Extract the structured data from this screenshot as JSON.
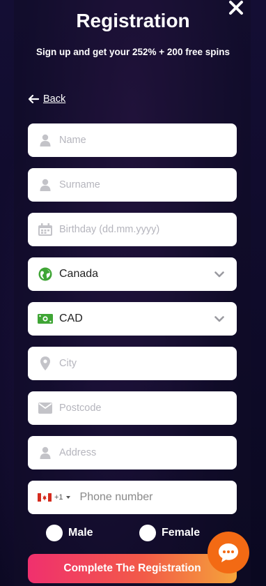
{
  "modal": {
    "title": "Registration",
    "subtitle": "Sign up and get your 252% + 200 free spins",
    "close_icon": "close-icon"
  },
  "back": {
    "label": "Back",
    "icon": "arrow-left-icon"
  },
  "fields": {
    "name": {
      "placeholder": "Name",
      "icon": "user-icon"
    },
    "surname": {
      "placeholder": "Surname",
      "icon": "user-icon"
    },
    "birthday": {
      "placeholder": "Birthday (dd.mm.yyyy)",
      "icon": "calendar-icon"
    },
    "country": {
      "value": "Canada",
      "icon": "globe-icon"
    },
    "currency": {
      "value": "CAD",
      "icon": "banknote-icon"
    },
    "city": {
      "placeholder": "City",
      "icon": "location-pin-icon"
    },
    "postcode": {
      "placeholder": "Postcode",
      "icon": "mailbox-icon"
    },
    "address": {
      "placeholder": "Address",
      "icon": "user-icon"
    },
    "phone": {
      "code": "+1",
      "placeholder": "Phone number",
      "flag": "canada-flag-icon"
    }
  },
  "gender": {
    "male": "Male",
    "female": "Female"
  },
  "submit_label": "Complete The Registration",
  "colors": {
    "accent_green": "#3fa535",
    "button_gradient_start": "#f0306e",
    "button_gradient_end": "#f5a43a",
    "chat_orange": "#f36a14"
  }
}
